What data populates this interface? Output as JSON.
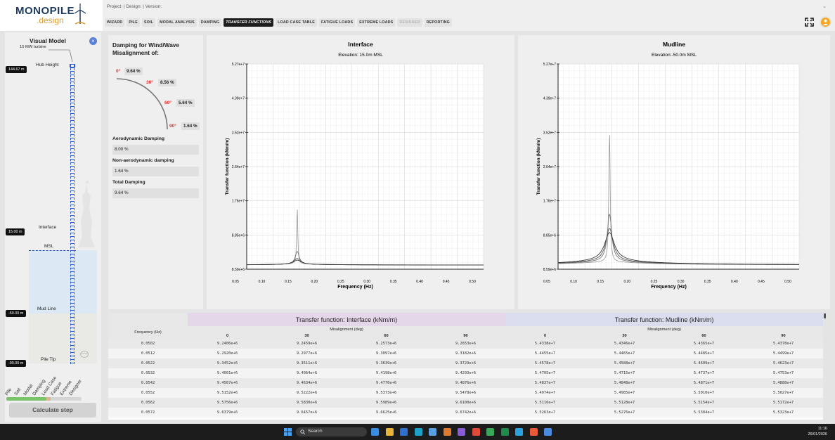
{
  "logo": {
    "main": "MONOPILE",
    "sub": ".design"
  },
  "header": {
    "project_line": "Project: | Design: | Version:"
  },
  "nav": {
    "tabs": [
      {
        "label": "WIZARD",
        "state": "normal"
      },
      {
        "label": "PILE",
        "state": "normal"
      },
      {
        "label": "SOIL",
        "state": "normal"
      },
      {
        "label": "MODAL ANALYSIS",
        "state": "normal"
      },
      {
        "label": "DAMPING",
        "state": "normal"
      },
      {
        "label": "TRANSFER FUNCTIONS",
        "state": "active"
      },
      {
        "label": "LOAD CASE TABLE",
        "state": "normal"
      },
      {
        "label": "FATIGUE LOADS",
        "state": "normal"
      },
      {
        "label": "EXTREME LOADS",
        "state": "normal"
      },
      {
        "label": "DESIGNER",
        "state": "disabled"
      },
      {
        "label": "REPORTING",
        "state": "normal"
      }
    ]
  },
  "visual_model": {
    "title": "Visual Model",
    "turbine": "15 MW turbine",
    "hub_height_label": "Hub Height",
    "hub_height_value": "144.67 m",
    "interface_label": "Interface",
    "interface_value": "15.00 m",
    "msl_label": "MSL",
    "mudline_label": "Mud Line",
    "mudline_value": "-50.00 m",
    "pile_tip_label": "Pile Tip",
    "pile_tip_value": "-90.00 m",
    "steps": [
      "Pile",
      "Soil",
      "Modal",
      "Damping",
      "Load Case",
      "Fatigue",
      "Extreme",
      "Designer"
    ],
    "progress_complete": 0.53,
    "progress_partial": 0.06,
    "calculate_label": "Calculate step"
  },
  "damping": {
    "title": "Damping for Wind/Wave Misalignment of:",
    "angles": [
      {
        "angle": "0°",
        "value": "9.64 %"
      },
      {
        "angle": "30°",
        "value": "8.56 %"
      },
      {
        "angle": "60°",
        "value": "5.64 %"
      },
      {
        "angle": "90°",
        "value": "1.64 %"
      }
    ],
    "aero_label": "Aerodynamic Damping",
    "aero_value": "8.00 %",
    "nonaero_label": "Non-aerodynamic damping",
    "nonaero_value": "1.64 %",
    "total_label": "Total Damping",
    "total_value": "9.64 %"
  },
  "chart_data": [
    {
      "type": "line",
      "title": "Interface",
      "subtitle": "Elevation: 15.0m MSL",
      "xlabel": "Frequency (Hz)",
      "ylabel": "Transfer function (kNm/m)",
      "xlim": [
        0.05,
        0.5
      ],
      "ylim": [
        8590000,
        52700000
      ],
      "xticks": [
        "0.05",
        "0.10",
        "0.15",
        "0.20",
        "0.25",
        "0.30",
        "0.35",
        "0.40",
        "0.45",
        "0.50"
      ],
      "yticks": [
        "8.59e+6",
        "8.85e+6",
        "1.76e+7",
        "2.64e+7",
        "3.52e+7",
        "4.39e+7",
        "5.27e+7"
      ],
      "grid": true,
      "peak_freq": 0.146,
      "series": [
        {
          "peak": 27200000,
          "width": 0.0012
        },
        {
          "peak": 13400000,
          "width": 0.0045
        },
        {
          "peak": 11300000,
          "width": 0.0075
        },
        {
          "peak": 10800000,
          "width": 0.0095
        }
      ]
    },
    {
      "type": "line",
      "title": "Mudline",
      "subtitle": "Elevation:-50.0m MSL",
      "xlabel": "Frequency (Hz)",
      "ylabel": "Transfer function (kNm/m)",
      "xlim": [
        0.05,
        0.5
      ],
      "ylim": [
        8590000,
        52700000
      ],
      "xticks": [
        "0.05",
        "0.10",
        "0.15",
        "0.20",
        "0.25",
        "0.30",
        "0.35",
        "0.40",
        "0.45",
        "0.50"
      ],
      "yticks": [
        "8.59e+6",
        "8.85e+6",
        "1.76e+7",
        "2.64e+7",
        "3.52e+7",
        "4.39e+7",
        "5.27e+7"
      ],
      "grid": true,
      "peak_freq": 0.146,
      "series": [
        {
          "peak": 50000000,
          "width": 0.0015
        },
        {
          "peak": 24000000,
          "width": 0.005
        },
        {
          "peak": 19500000,
          "width": 0.008
        },
        {
          "peak": 18000000,
          "width": 0.011
        }
      ]
    }
  ],
  "table": {
    "interface_header": "Transfer function: Interface (kNm/m)",
    "mudline_header": "Transfer function: Mudline (kNm/m)",
    "freq_header": "Frequency (Hz)",
    "misalignment_label": "Misalignment (deg)",
    "angles": [
      "0",
      "30",
      "60",
      "90"
    ],
    "rows": [
      [
        "0.0502",
        "9.2406e+6",
        "9.2459e+6",
        "9.2573e+6",
        "9.2653e+6",
        "5.4338e+7",
        "5.4346e+7",
        "5.4365e+7",
        "5.4378e+7"
      ],
      [
        "0.0512",
        "9.2920e+6",
        "9.2977e+6",
        "9.3097e+6",
        "9.3182e+6",
        "5.4455e+7",
        "5.4465e+7",
        "5.4485e+7",
        "5.4499e+7"
      ],
      [
        "0.0522",
        "9.3452e+6",
        "9.3511e+6",
        "9.3639e+6",
        "9.3729e+6",
        "5.4578e+7",
        "5.4588e+7",
        "5.4609e+7",
        "5.4623e+7"
      ],
      [
        "0.0532",
        "9.4001e+6",
        "9.4064e+6",
        "9.4198e+6",
        "9.4293e+6",
        "5.4705e+7",
        "5.4715e+7",
        "5.4737e+7",
        "5.4753e+7"
      ],
      [
        "0.0542",
        "9.4567e+6",
        "9.4634e+6",
        "9.4776e+6",
        "9.4876e+6",
        "5.4837e+7",
        "5.4848e+7",
        "5.4871e+7",
        "5.4888e+7"
      ],
      [
        "0.0552",
        "9.5152e+6",
        "9.5222e+6",
        "9.5373e+6",
        "9.5478e+6",
        "5.4974e+7",
        "5.4985e+7",
        "5.5010e+7",
        "5.5027e+7"
      ],
      [
        "0.0562",
        "9.5756e+6",
        "9.5830e+6",
        "9.5989e+6",
        "9.6100e+6",
        "5.5116e+7",
        "5.5128e+7",
        "5.5154e+7",
        "5.5172e+7"
      ],
      [
        "0.0572",
        "9.6379e+6",
        "9.6457e+6",
        "9.6625e+6",
        "9.6742e+6",
        "5.5263e+7",
        "5.5276e+7",
        "5.5304e+7",
        "5.5323e+7"
      ]
    ]
  },
  "taskbar": {
    "search_placeholder": "Search",
    "time": "11:16",
    "date": "26/01/2026",
    "apps": [
      "files-icon",
      "folder-icon",
      "mail-icon",
      "edge-icon",
      "store-icon",
      "app1-icon",
      "app2-icon",
      "brave-icon",
      "app3-icon",
      "excel-icon",
      "telegram-icon",
      "app4-icon",
      "app5-icon"
    ]
  }
}
